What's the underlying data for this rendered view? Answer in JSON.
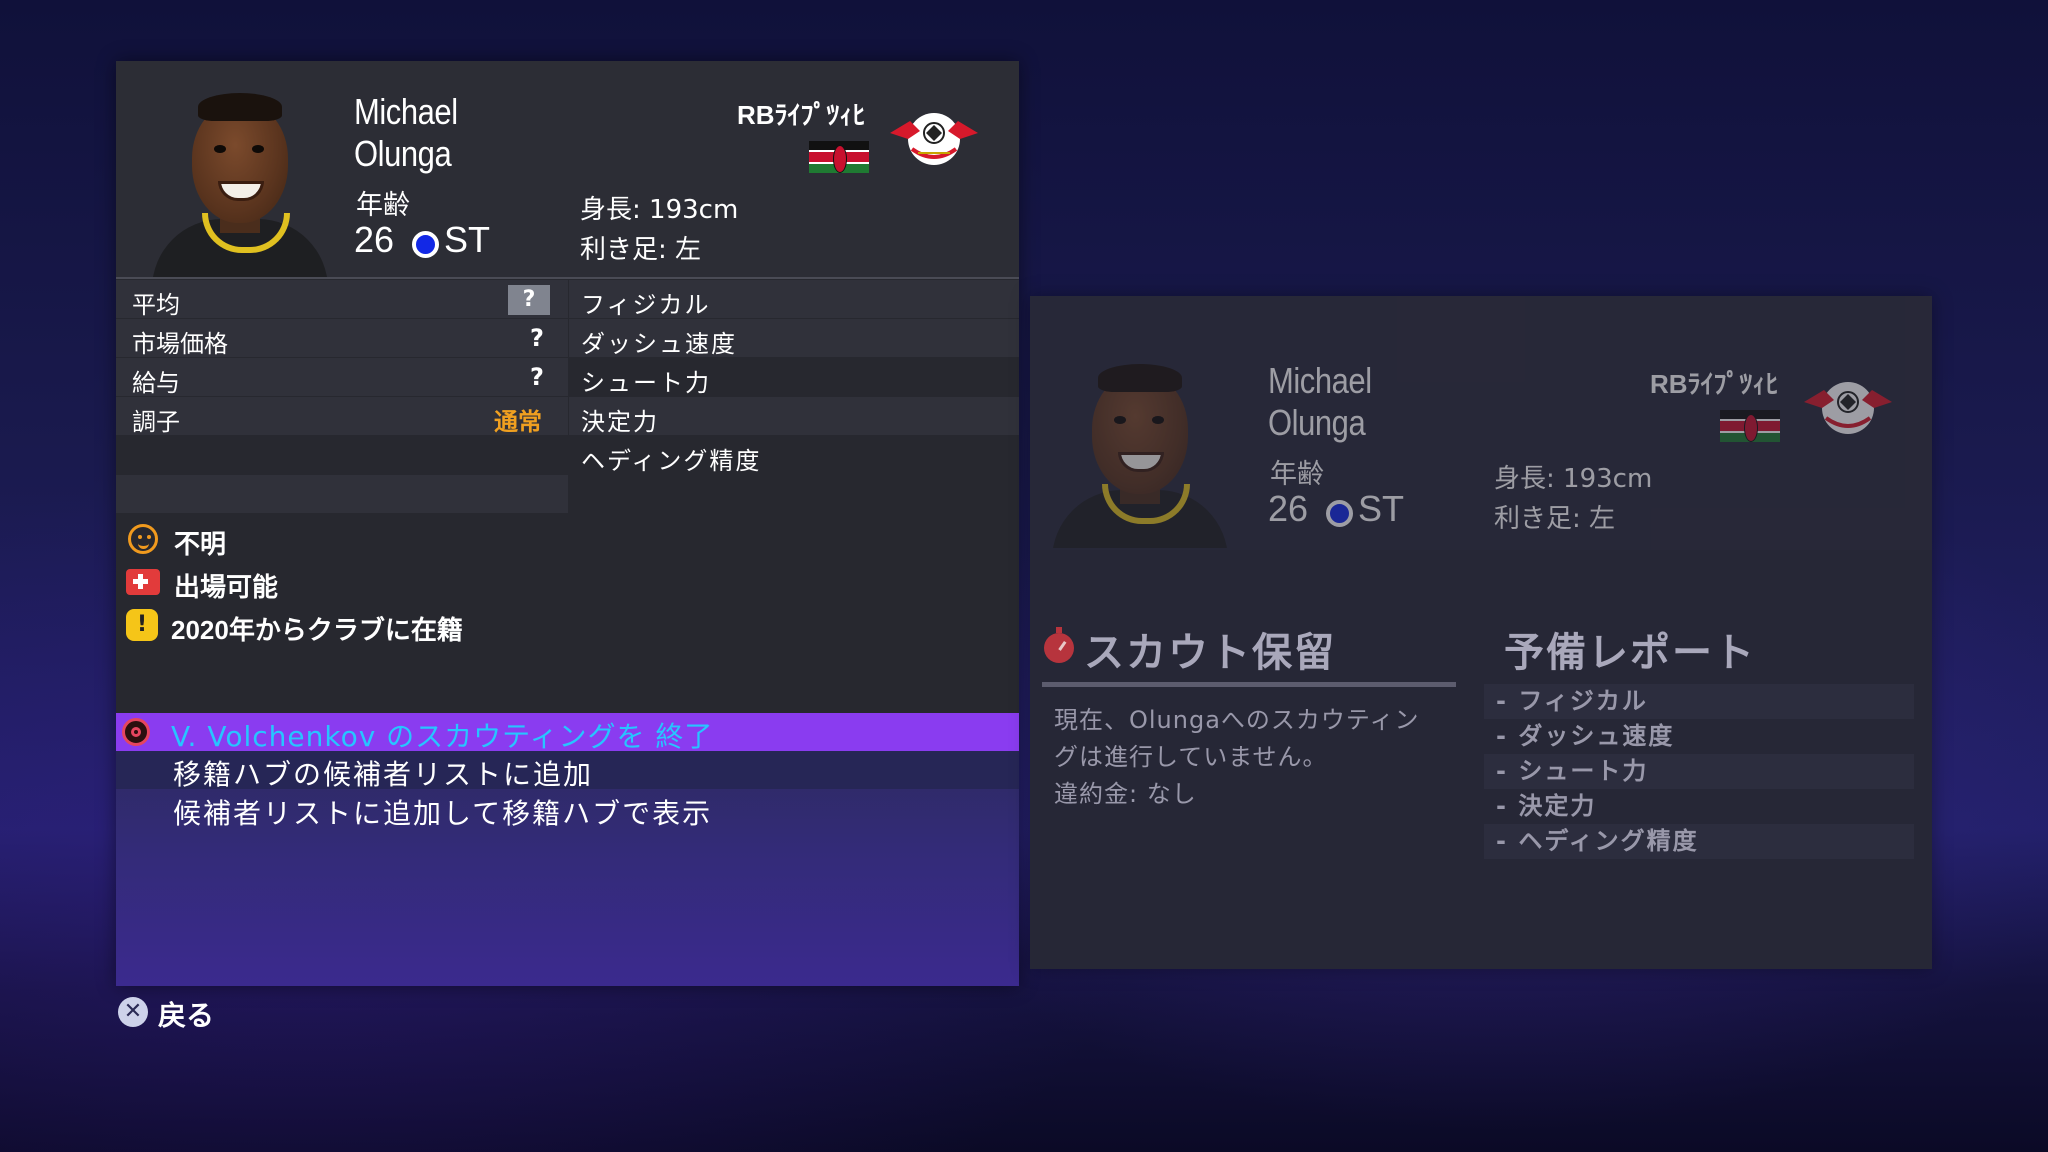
{
  "player": {
    "first_name": "Michael",
    "last_name": "Olunga",
    "age_label": "年齢",
    "age": "26",
    "position": "ST",
    "club": "RBﾗｲﾌﾟﾂｨﾋ",
    "height": "身長: 193cm",
    "foot": "利き足: 左"
  },
  "stats": [
    {
      "label": "平均",
      "value": "?"
    },
    {
      "label": "市場価格",
      "value": "?"
    },
    {
      "label": "給与",
      "value": "?"
    },
    {
      "label": "調子",
      "value": "通常"
    }
  ],
  "attributes": [
    "フィジカル",
    "ダッシュ速度",
    "シュート力",
    "決定力",
    "ヘディング精度"
  ],
  "status": {
    "mood": "不明",
    "injury": "出場可能",
    "tenure": "2020年からクラブに在籍"
  },
  "menu": {
    "selected": "V. Volchenkov のスカウティングを 終了",
    "item2": "移籍ハブの候補者リストに追加",
    "item3": "候補者リストに追加して移籍ハブで表示"
  },
  "footer": {
    "back": "戻る",
    "back_icon": "cross-button-icon"
  },
  "scout": {
    "title": "スカウト保留",
    "body_line1": "現在、Olungaへのスカウティン",
    "body_line2": "グは進行していません。",
    "fee": "違約金: なし"
  },
  "report": {
    "title": "予備レポート",
    "items": [
      "- フィジカル",
      "- ダッシュ速度",
      "- シュート力",
      "- 決定力",
      "- ヘディング精度"
    ]
  },
  "colors": {
    "accent_purple": "#8a3cf0",
    "selected_text": "#27c5ff",
    "form_orange": "#f0a020",
    "position_blue": "#1228e6"
  }
}
